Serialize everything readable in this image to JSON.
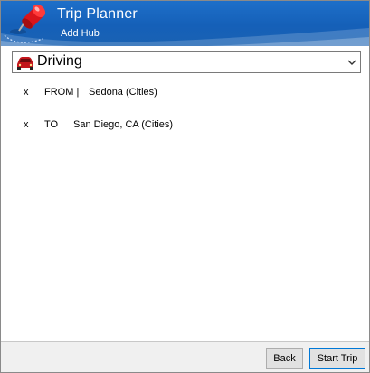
{
  "header": {
    "title": "Trip Planner",
    "subtitle": "Add Hub",
    "icons": {
      "logo": "red-pushpin-icon"
    }
  },
  "mode": {
    "selected": "Driving",
    "icon": "car-icon",
    "dropdown_icon": "chevron-down-icon"
  },
  "hubs": [
    {
      "remove": "x",
      "kind": "FROM |",
      "name": "Sedona (Cities)"
    },
    {
      "remove": "x",
      "kind": "TO |",
      "name": "San Diego, CA (Cities)"
    }
  ],
  "footer": {
    "back_label": "Back",
    "start_label": "Start Trip"
  },
  "colors": {
    "header_blue": "#1560b8",
    "pin_red": "#d9151b",
    "button_bg": "#e1e1e1",
    "focus_border": "#0078d7"
  }
}
